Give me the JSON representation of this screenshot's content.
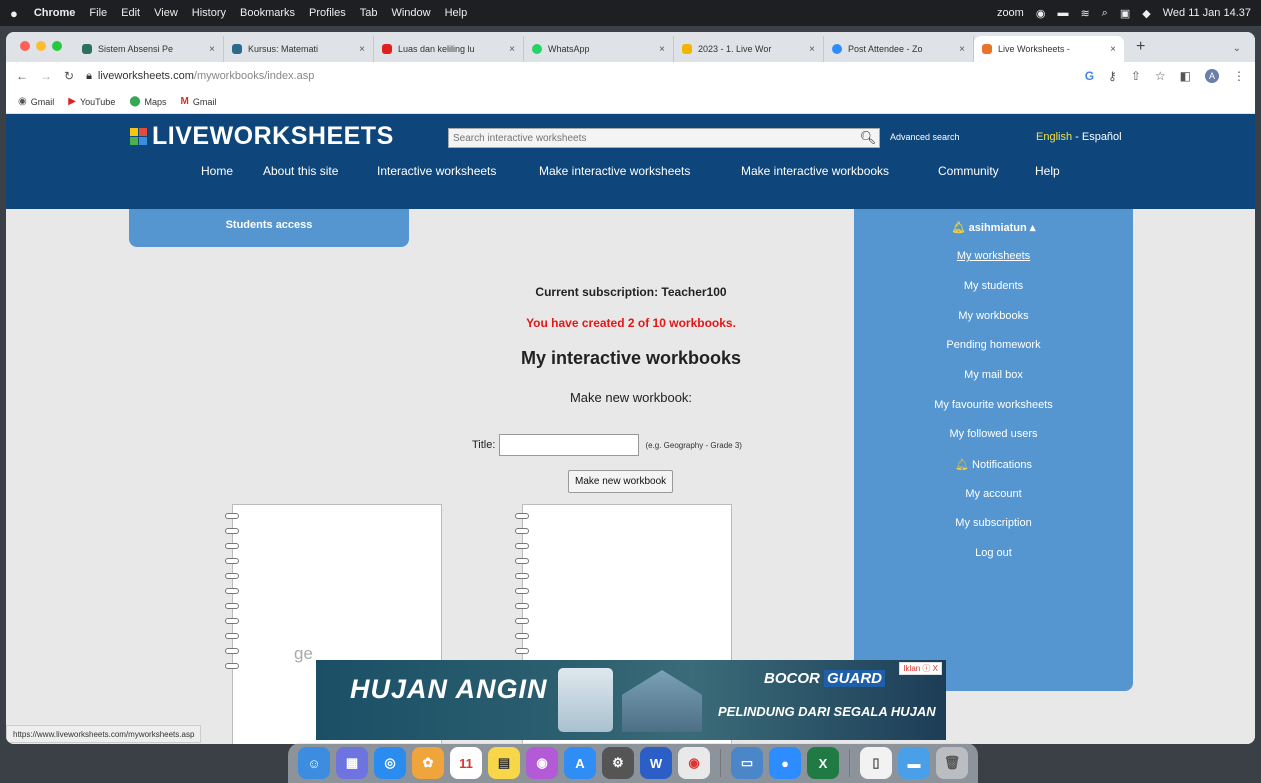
{
  "menubar": {
    "app": "Chrome",
    "items": [
      "File",
      "Edit",
      "View",
      "History",
      "Bookmarks",
      "Profiles",
      "Tab",
      "Window",
      "Help"
    ],
    "zoom": "zoom",
    "datetime": "Wed 11 Jan  14.37"
  },
  "tabs": [
    {
      "title": "Sistem Absensi Pe",
      "color": "#2f6f5e"
    },
    {
      "title": "Kursus: Matemati",
      "color": "#2b6a8a"
    },
    {
      "title": "Luas dan keliling lu",
      "color": "#e02020"
    },
    {
      "title": "WhatsApp",
      "color": "#25d366"
    },
    {
      "title": "2023 - 1. Live Wor",
      "color": "#f4b400"
    },
    {
      "title": "Post Attendee - Zo",
      "color": "#2d8cff"
    },
    {
      "title": "Live Worksheets -",
      "color": "#e8732a"
    }
  ],
  "browser": {
    "url_domain": "liveworksheets.com",
    "url_path": "/myworkbooks/index.asp",
    "bookmarks": [
      "Gmail",
      "YouTube",
      "Maps",
      "Gmail"
    ]
  },
  "site": {
    "logo": "LIVEWORKSHEETS",
    "search_placeholder": "Search interactive worksheets",
    "advanced_search": "Advanced search",
    "lang_en": "English",
    "lang_sep": " - ",
    "lang_es": "Español",
    "nav": [
      "Home",
      "About this site",
      "Interactive worksheets",
      "Make interactive worksheets",
      "Make interactive workbooks",
      "Community",
      "Help"
    ],
    "students_access": "Students access"
  },
  "main": {
    "subscription": "Current subscription: Teacher100",
    "created": "You have created 2 of 10 workbooks.",
    "heading": "My interactive workbooks",
    "make_new_label": "Make new workbook:",
    "title_label": "Title:",
    "title_value": "",
    "title_example": "(e.g. Geography - Grade 3)",
    "make_button": "Make new workbook",
    "ghost_text": "ge"
  },
  "sidebar": {
    "username": "asihmiatun",
    "items": [
      "My worksheets",
      "My students",
      "My workbooks",
      "Pending homework",
      "My mail box",
      "My favourite worksheets",
      "My followed users"
    ],
    "notifications": "Notifications",
    "items2": [
      "My account",
      "My subscription",
      "Log out"
    ]
  },
  "ad": {
    "headline": "HUJAN ANGIN",
    "brand1": "BOCOR",
    "brand2": "GUARD",
    "tagline": "PELINDUNG DARI SEGALA HUJAN",
    "close": "Iklan ⓘ X"
  },
  "status_url": "https://www.liveworksheets.com/myworksheets.asp",
  "dock_calendar_day": "11"
}
